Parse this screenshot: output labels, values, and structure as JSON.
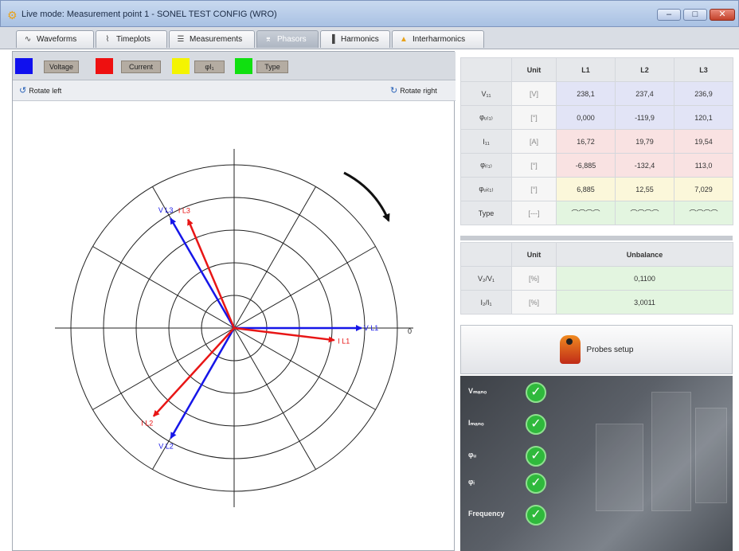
{
  "window": {
    "title": "Live mode: Measurement point 1 - SONEL TEST CONFIG (WRO)",
    "minimize": "–",
    "maximize": "□",
    "close": "✕"
  },
  "tabs": [
    {
      "label": "Waveforms",
      "icon": "waveform-icon",
      "glyph": "∿"
    },
    {
      "label": "Timeplots",
      "icon": "timeplot-icon",
      "glyph": "⌇"
    },
    {
      "label": "Measurements",
      "icon": "table-icon",
      "glyph": "☰"
    },
    {
      "label": "Phasors",
      "icon": "phasor-icon",
      "glyph": "⌆",
      "active": true
    },
    {
      "label": "Harmonics",
      "icon": "bar-chart-icon",
      "glyph": "▐"
    },
    {
      "label": "Interharmonics",
      "icon": "interharmonic-icon",
      "glyph": "▲"
    }
  ],
  "legend": {
    "voltage": {
      "label": "Voltage",
      "color": "#1010ee"
    },
    "current": {
      "label": "Current",
      "color": "#ee1010"
    },
    "phi": {
      "label": "φI₁",
      "color": "#f4f400"
    },
    "type": {
      "label": "Type",
      "color": "#10e010"
    }
  },
  "rotate": {
    "left": "Rotate left",
    "right": "Rotate right"
  },
  "phasor": {
    "zero_label": "0",
    "rings": 5,
    "vectors": [
      {
        "name": "V L1",
        "kind": "voltage",
        "angle_deg": 0,
        "magnitude": 238.1
      },
      {
        "name": "V L2",
        "kind": "voltage",
        "angle_deg": -119.9,
        "magnitude": 237.4
      },
      {
        "name": "V L3",
        "kind": "voltage",
        "angle_deg": 120.1,
        "magnitude": 236.9
      },
      {
        "name": "I L1",
        "kind": "current",
        "angle_deg": -6.885,
        "magnitude": 16.72
      },
      {
        "name": "I L2",
        "kind": "current",
        "angle_deg": -132.4,
        "magnitude": 19.79
      },
      {
        "name": "I L3",
        "kind": "current",
        "angle_deg": 113.0,
        "magnitude": 19.54
      }
    ]
  },
  "table1": {
    "headers": [
      "",
      "Unit",
      "L1",
      "L2",
      "L3"
    ],
    "rows": [
      {
        "label": "V₁₁",
        "unit": "[V]",
        "values": [
          "238,1",
          "237,4",
          "236,9"
        ],
        "bg": "blue"
      },
      {
        "label": "φᵤ₍₁₎",
        "unit": "[°]",
        "values": [
          "0,000",
          "-119,9",
          "120,1"
        ],
        "bg": "blue"
      },
      {
        "label": "I₁₁",
        "unit": "[A]",
        "values": [
          "16,72",
          "19,79",
          "19,54"
        ],
        "bg": "red"
      },
      {
        "label": "φᵢ₍₁₎",
        "unit": "[°]",
        "values": [
          "-6,885",
          "-132,4",
          "113,0"
        ],
        "bg": "red"
      },
      {
        "label": "φᵤᵢ₍₁₎",
        "unit": "[°]",
        "values": [
          "6,885",
          "12,55",
          "7,029"
        ],
        "bg": "yellow"
      },
      {
        "label": "Type",
        "unit": "[---]",
        "values": [
          "⌒⌒⌒⌒",
          "⌒⌒⌒⌒",
          "⌒⌒⌒⌒"
        ],
        "bg": "green"
      }
    ]
  },
  "table2": {
    "headers": [
      "",
      "Unit",
      "Unbalance"
    ],
    "rows": [
      {
        "label": "V₂/V₁",
        "unit": "[%]",
        "value": "0,1100"
      },
      {
        "label": "I₂/I₁",
        "unit": "[%]",
        "value": "3,0011"
      }
    ]
  },
  "probes": {
    "label": "Probes setup"
  },
  "status": [
    {
      "label": "Vₘₐₙₒ",
      "state": "ok"
    },
    {
      "label": "Iₘₐₙₒ",
      "state": "ok"
    },
    {
      "label": "φᵤ",
      "state": "ok"
    },
    {
      "label": "φᵢ",
      "state": "ok"
    },
    {
      "label": "Frequency",
      "state": "ok"
    }
  ],
  "status_check": "✓"
}
